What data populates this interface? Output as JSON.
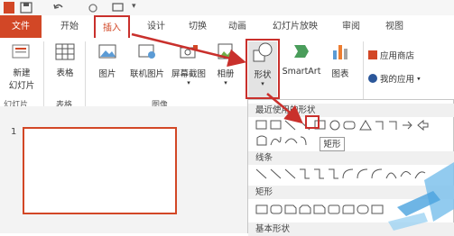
{
  "tabs": {
    "file": "文件",
    "home": "开始",
    "insert": "插入",
    "design": "设计",
    "transitions": "切换",
    "animations": "动画",
    "slideshow": "幻灯片放映",
    "review": "审阅",
    "view": "视图"
  },
  "ribbon": {
    "new_slide_1": "新建",
    "new_slide_2": "幻灯片",
    "table": "表格",
    "picture": "图片",
    "online_picture": "联机图片",
    "screenshot": "屏幕截图",
    "album": "相册",
    "shapes": "形状",
    "smartart": "SmartArt",
    "chart": "图表",
    "app_store": "应用商店",
    "my_apps": "我的应用"
  },
  "groups": {
    "slides": "幻灯片",
    "tables": "表格",
    "images": "图像"
  },
  "slide_panel": {
    "slide_number": "1"
  },
  "shapes_menu": {
    "recent": "最近使用的形状",
    "lines": "线条",
    "rectangles": "矩形",
    "basic": "基本形状"
  },
  "tooltip": "矩形",
  "colors": {
    "accent": "#d24726",
    "annotation": "#c9302c"
  }
}
